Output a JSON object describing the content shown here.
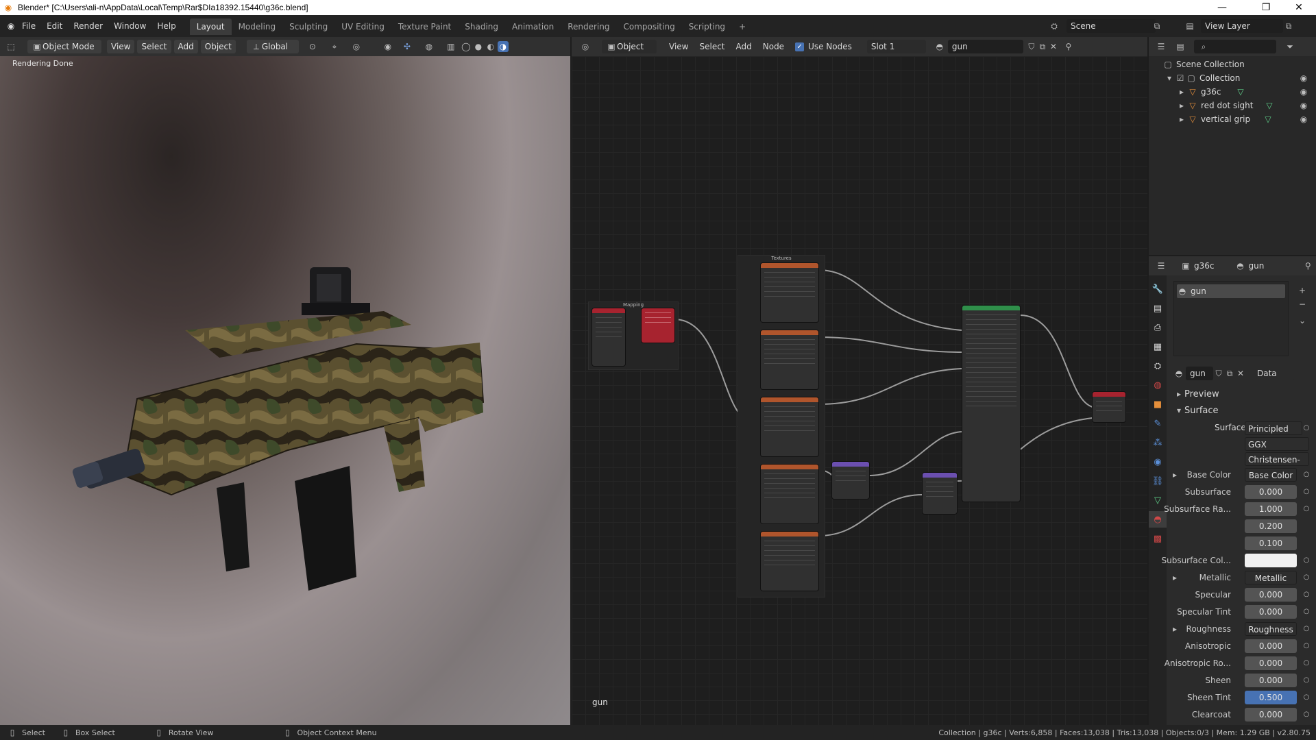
{
  "window": {
    "title": "Blender* [C:\\Users\\ali-n\\AppData\\Local\\Temp\\Rar$DIa18392.15440\\g36c.blend]",
    "controls": [
      "—",
      "❐",
      "✕"
    ]
  },
  "menu": [
    "File",
    "Edit",
    "Render",
    "Window",
    "Help"
  ],
  "workspaces": [
    "Layout",
    "Modeling",
    "Sculpting",
    "UV Editing",
    "Texture Paint",
    "Shading",
    "Animation",
    "Rendering",
    "Compositing",
    "Scripting",
    "+"
  ],
  "active_workspace": "Layout",
  "scene": {
    "name": "Scene",
    "view_layer": "View Layer"
  },
  "viewport": {
    "mode": "Object Mode",
    "menus": [
      "View",
      "Select",
      "Add",
      "Object"
    ],
    "orientation": "Global",
    "overlay_text": "Rendering Done"
  },
  "node_editor": {
    "type": "Object",
    "menus": [
      "View",
      "Select",
      "Add",
      "Node"
    ],
    "use_nodes_label": "Use Nodes",
    "slot": "Slot 1",
    "material": "gun",
    "footer_label": "gun",
    "frame_labels": [
      "Mapping",
      "Textures"
    ]
  },
  "outliner": {
    "root": "Scene Collection",
    "collection": "Collection",
    "objects": [
      "g36c",
      "red dot sight",
      "vertical grip"
    ]
  },
  "properties": {
    "object": "g36c",
    "material": "gun",
    "slot_item": "gun",
    "data_link": "Data",
    "panels": [
      "Preview",
      "Surface"
    ],
    "surface": "Principled B...",
    "distribution": "GGX",
    "subsurface_method": "Christensen-B...",
    "rows": [
      {
        "label": "Base Color",
        "value": "Base Color",
        "kind": "link",
        "expand": true
      },
      {
        "label": "Subsurface",
        "value": "0.000",
        "kind": "num"
      },
      {
        "label": "Subsurface Ra...",
        "value": "1.000",
        "kind": "num"
      },
      {
        "label": "",
        "value": "0.200",
        "kind": "num"
      },
      {
        "label": "",
        "value": "0.100",
        "kind": "num"
      },
      {
        "label": "Subsurface Col...",
        "value": "",
        "kind": "color"
      },
      {
        "label": "Metallic",
        "value": "Metallic",
        "kind": "link",
        "expand": true
      },
      {
        "label": "Specular",
        "value": "0.000",
        "kind": "num"
      },
      {
        "label": "Specular Tint",
        "value": "0.000",
        "kind": "num"
      },
      {
        "label": "Roughness",
        "value": "Roughness",
        "kind": "link",
        "expand": true
      },
      {
        "label": "Anisotropic",
        "value": "0.000",
        "kind": "num"
      },
      {
        "label": "Anisotropic Ro...",
        "value": "0.000",
        "kind": "num"
      },
      {
        "label": "Sheen",
        "value": "0.000",
        "kind": "num"
      },
      {
        "label": "Sheen Tint",
        "value": "0.500",
        "kind": "active"
      },
      {
        "label": "Clearcoat",
        "value": "0.000",
        "kind": "num"
      }
    ]
  },
  "statusbar": {
    "left": [
      {
        "key": "Select"
      },
      {
        "key": "Box Select"
      },
      {
        "key": "Rotate View"
      },
      {
        "key": "Object Context Menu"
      }
    ],
    "right": "Collection | g36c | Verts:6,858 | Faces:13,038 | Tris:13,038 | Objects:0/3 | Mem: 1.29 GB | v2.80.75"
  },
  "colors": {
    "accent_blue": "#4772b3",
    "texture_node": "#b0552c",
    "shader_node": "#2f8f4a",
    "vector_node": "#6b4fb0",
    "output_node": "#a7232f"
  }
}
